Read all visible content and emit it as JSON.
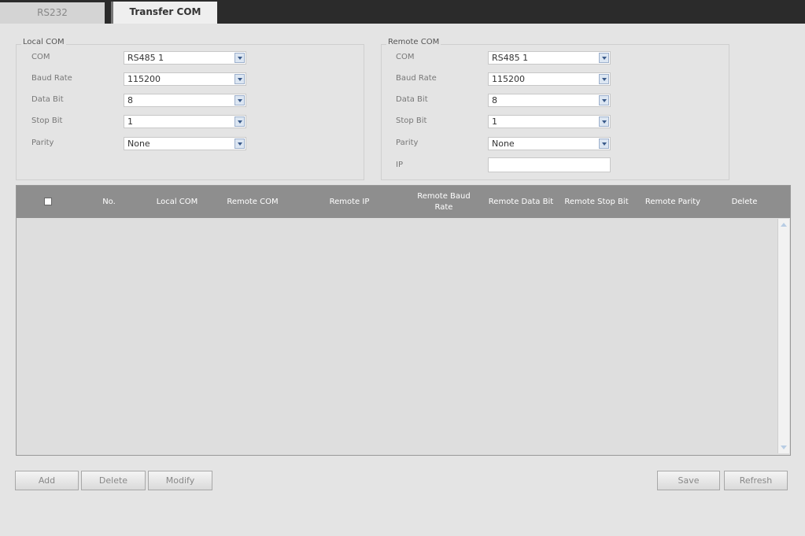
{
  "tabs": [
    {
      "label": "RS232"
    },
    {
      "label": "Transfer COM"
    }
  ],
  "local_com": {
    "title": "Local COM",
    "fields": [
      {
        "label": "COM",
        "value": "RS485 1"
      },
      {
        "label": "Baud Rate",
        "value": "115200"
      },
      {
        "label": "Data Bit",
        "value": "8"
      },
      {
        "label": "Stop Bit",
        "value": "1"
      },
      {
        "label": "Parity",
        "value": "None"
      }
    ]
  },
  "remote_com": {
    "title": "Remote COM",
    "fields": [
      {
        "label": "COM",
        "value": "RS485 1"
      },
      {
        "label": "Baud Rate",
        "value": "115200"
      },
      {
        "label": "Data Bit",
        "value": "8"
      },
      {
        "label": "Stop Bit",
        "value": "1"
      },
      {
        "label": "Parity",
        "value": "None"
      }
    ],
    "ip_label": "IP",
    "ip_value": ""
  },
  "table": {
    "columns": [
      "No.",
      "Local COM",
      "Remote COM",
      "Remote IP",
      "Remote Baud Rate",
      "Remote Data Bit",
      "Remote Stop Bit",
      "Remote Parity",
      "Delete"
    ],
    "rows": []
  },
  "buttons": {
    "add": "Add",
    "delete": "Delete",
    "modify": "Modify",
    "save": "Save",
    "refresh": "Refresh"
  }
}
